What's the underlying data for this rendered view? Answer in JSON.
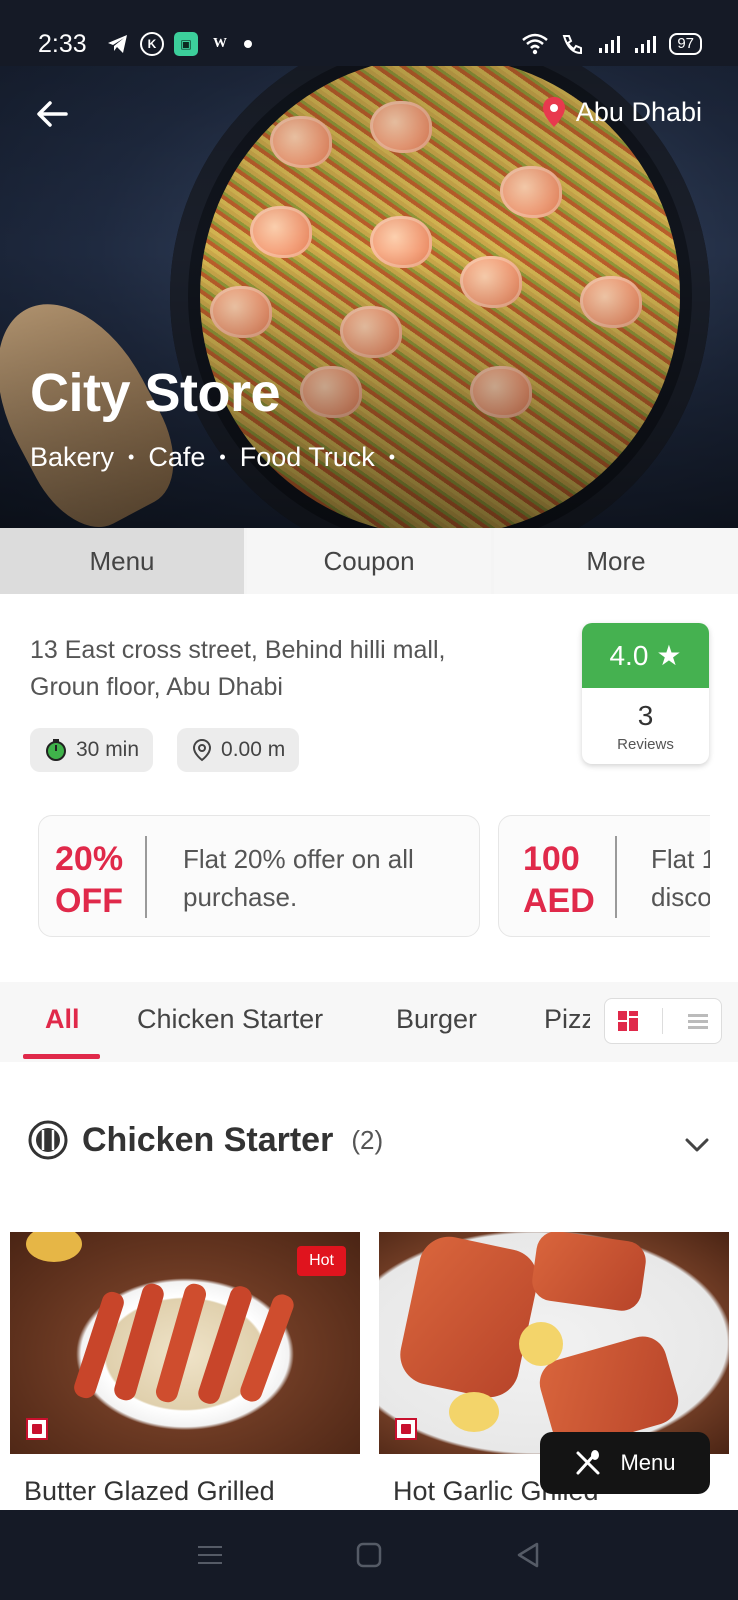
{
  "status_bar": {
    "time": "2:33",
    "battery": "97"
  },
  "hero": {
    "location": "Abu Dhabi",
    "store_name": "City Store",
    "categories": [
      "Bakery",
      "Cafe",
      "Food Truck"
    ]
  },
  "tabs": [
    {
      "label": "Menu",
      "active": true
    },
    {
      "label": "Coupon",
      "active": false
    },
    {
      "label": "More",
      "active": false
    }
  ],
  "store_info": {
    "address_line1": "13 East cross street, Behind hilli mall,",
    "address_line2": "Groun floor, Abu Dhabi",
    "delivery_time": "30 min",
    "distance": "0.00 m",
    "rating": "4.0",
    "review_count": "3",
    "reviews_label": "Reviews"
  },
  "offers": [
    {
      "big_line1": "20%",
      "big_line2": "OFF",
      "desc_line1": "Flat 20% offer on all",
      "desc_line2": "purchase."
    },
    {
      "big_line1": "100",
      "big_line2": "AED",
      "desc_line1": "Flat 1",
      "desc_line2": "disco"
    }
  ],
  "menu_categories": [
    {
      "label": "All",
      "active": true
    },
    {
      "label": "Chicken Starter",
      "active": false
    },
    {
      "label": "Burger",
      "active": false
    },
    {
      "label": "Pizza",
      "active": false
    }
  ],
  "section": {
    "title": "Chicken Starter",
    "count": "(2)"
  },
  "products": [
    {
      "title": "Butter Glazed Grilled",
      "badge": "Hot"
    },
    {
      "title": "Hot Garlic Grilled",
      "badge": ""
    }
  ],
  "fab": {
    "label": "Menu"
  },
  "colors": {
    "accent": "#e0294a",
    "rating_green": "#45b150",
    "dark": "#151a26"
  }
}
